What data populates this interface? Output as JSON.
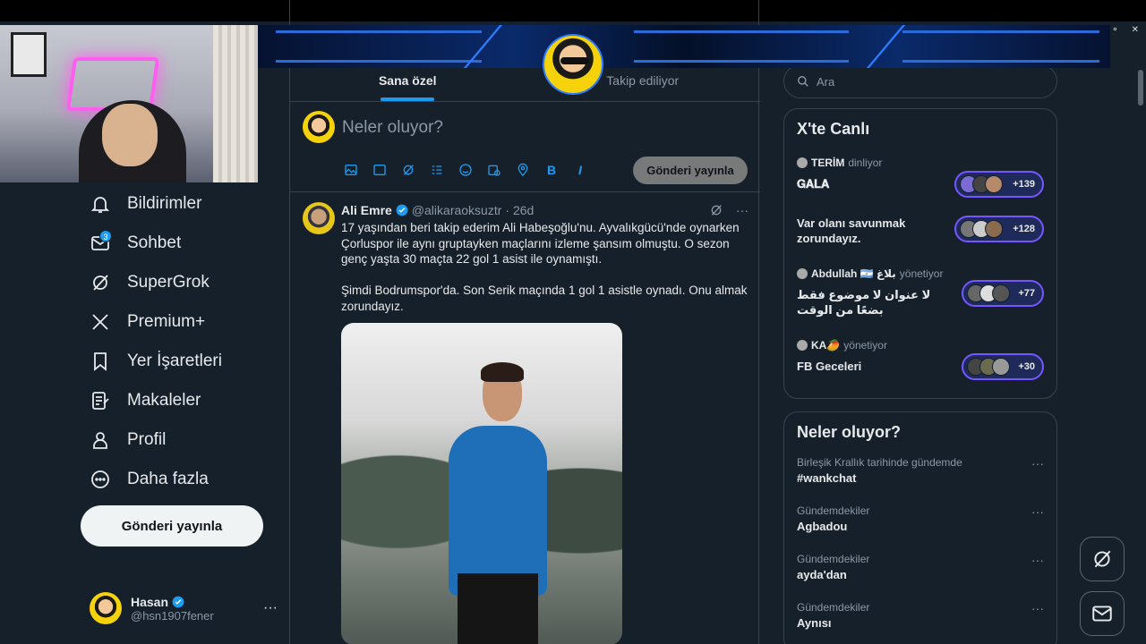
{
  "window": {
    "controls": [
      "⚬",
      "✕"
    ]
  },
  "nav": {
    "items": [
      {
        "label": "Bildirimler",
        "icon": "bell-icon"
      },
      {
        "label": "Sohbet",
        "icon": "mail-icon",
        "badge": "3"
      },
      {
        "label": "SuperGrok",
        "icon": "grok-icon"
      },
      {
        "label": "Premium+",
        "icon": "x-logo-icon"
      },
      {
        "label": "Yer İşaretleri",
        "icon": "bookmark-icon"
      },
      {
        "label": "Makaleler",
        "icon": "article-icon"
      },
      {
        "label": "Profil",
        "icon": "person-icon"
      },
      {
        "label": "Daha fazla",
        "icon": "more-circle-icon"
      }
    ],
    "post_button": "Gönderi yayınla"
  },
  "account": {
    "name": "Hasan",
    "handle": "@hsn1907fener",
    "more": "···"
  },
  "tabs": [
    "Sana özel",
    "Takip ediliyor"
  ],
  "composer": {
    "placeholder": "Neler oluyor?",
    "submit": "Gönderi yayınla",
    "tools": [
      "image",
      "gif",
      "grok",
      "poll",
      "emoji",
      "schedule",
      "location",
      "B",
      "I"
    ]
  },
  "tweet": {
    "name": "Ali Emre",
    "handle": "@alikaraoksuztr",
    "time": "· 26d",
    "more": "···",
    "text": "17 yaşından beri takip ederim Ali Habeşoğlu'nu. Ayvalıkgücü'nde oynarken Çorluspor ile aynı gruptayken maçlarını izleme şansım olmuştu. O sezon genç yaşta 30 maçta 22 gol 1 asist ile oynamıştı.\n\nŞimdi Bodrumspor'da. Son Serik maçında 1 gol 1 asistle oynadı. Onu almak zorundayız."
  },
  "search": {
    "placeholder": "Ara"
  },
  "live": {
    "title": "X'te Canlı",
    "items": [
      {
        "host": "TERİM",
        "status": "dinliyor",
        "title": "𝐆𝐀𝐋𝐀",
        "count": "+139"
      },
      {
        "host": "",
        "status": "",
        "title": "Var olanı savunmak zorundayız.",
        "count": "+128"
      },
      {
        "host": "Abdullah 🇦🇷 بلاغ",
        "status": "yönetiyor",
        "title": "لا عنوان لا موضوع فقط بضعًا من الوقت",
        "count": "+77"
      },
      {
        "host": "KA🥭",
        "status": "yönetiyor",
        "title": "FB Geceleri",
        "count": "+30"
      }
    ]
  },
  "trends": {
    "title": "Neler oluyor?",
    "items": [
      {
        "context": "Birleşik Krallık tarihinde gündemde",
        "name": "#wankchat"
      },
      {
        "context": "Gündemdekiler",
        "name": "Agbadou"
      },
      {
        "context": "Gündemdekiler",
        "name": "ayda'dan"
      },
      {
        "context": "Gündemdekiler",
        "name": "Aynısı"
      }
    ],
    "more": "···"
  },
  "colors": {
    "accent": "#1d9bf0",
    "background": "#15202b",
    "border": "#38444d",
    "live": "#7856ff"
  }
}
